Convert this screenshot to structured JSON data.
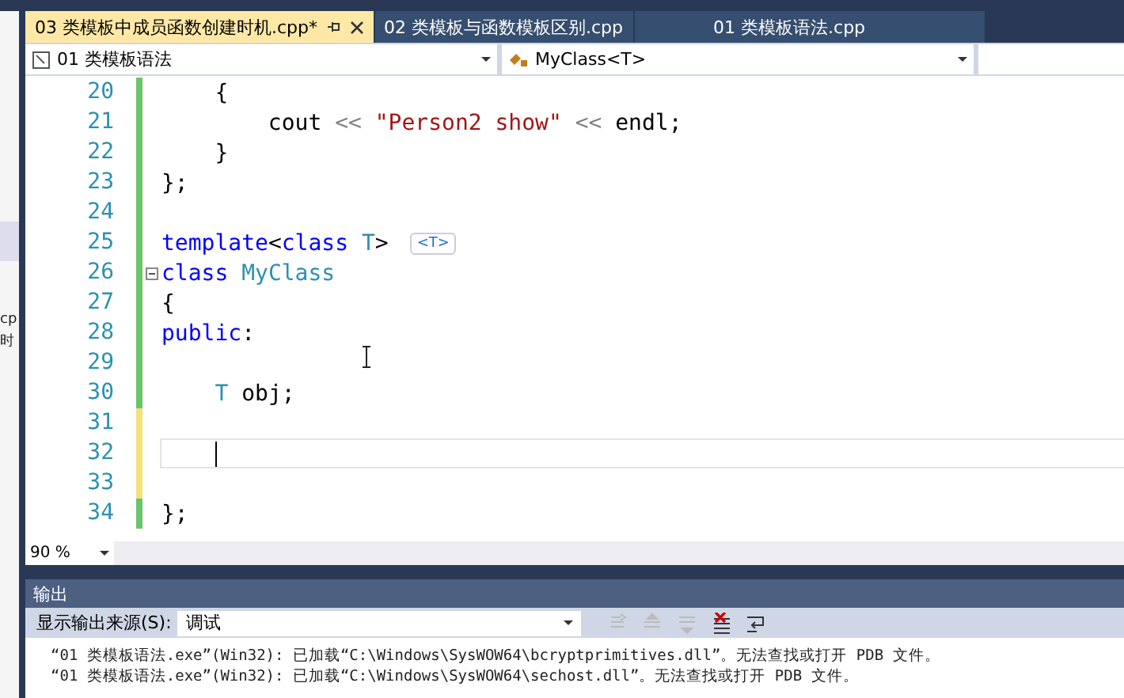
{
  "side_panel": {
    "texts": [
      "cp",
      "时"
    ]
  },
  "tabs": [
    {
      "label": "03 类模板中成员函数创建时机.cpp*",
      "selected": true,
      "pinned": true
    },
    {
      "label": "02 类模板与函数模板区别.cpp",
      "selected": false,
      "pinned": false
    },
    {
      "label": "01 类模板语法.cpp",
      "selected": false,
      "pinned": false
    }
  ],
  "nav_bar": {
    "project": "01 类模板语法",
    "scope": "MyClass<T>"
  },
  "editor": {
    "lines": [
      {
        "number": "20",
        "unsaved": false,
        "current": false,
        "tokens": [
          {
            "kind": "plain",
            "text": "    {"
          }
        ]
      },
      {
        "number": "21",
        "unsaved": false,
        "current": false,
        "tokens": [
          {
            "kind": "plain",
            "text": "        cout "
          },
          {
            "kind": "op",
            "text": "<< "
          },
          {
            "kind": "string",
            "text": "\"Person2 show\""
          },
          {
            "kind": "op",
            "text": " <<"
          },
          {
            "kind": "plain",
            "text": " endl;"
          }
        ]
      },
      {
        "number": "22",
        "unsaved": false,
        "current": false,
        "tokens": [
          {
            "kind": "plain",
            "text": "    }"
          }
        ]
      },
      {
        "number": "23",
        "unsaved": false,
        "current": false,
        "tokens": [
          {
            "kind": "plain",
            "text": "};"
          }
        ]
      },
      {
        "number": "24",
        "unsaved": false,
        "current": false
      },
      {
        "number": "25",
        "unsaved": false,
        "current": false,
        "tokens": [
          {
            "kind": "keyword",
            "text": "template"
          },
          {
            "kind": "plain",
            "text": "<"
          },
          {
            "kind": "keyword",
            "text": "class"
          },
          {
            "kind": "type",
            "text": " T"
          },
          {
            "kind": "plain",
            "text": ">"
          }
        ],
        "hint": "<T>"
      },
      {
        "number": "26",
        "unsaved": false,
        "current": false,
        "fold": true,
        "tokens": [
          {
            "kind": "keyword",
            "text": "class"
          },
          {
            "kind": "type",
            "text": " MyClass"
          }
        ]
      },
      {
        "number": "27",
        "unsaved": false,
        "current": false,
        "tokens": [
          {
            "kind": "plain",
            "text": "{"
          }
        ]
      },
      {
        "number": "28",
        "unsaved": false,
        "current": false,
        "tokens": [
          {
            "kind": "keyword",
            "text": "public"
          },
          {
            "kind": "plain",
            "text": ":"
          }
        ]
      },
      {
        "number": "29",
        "unsaved": false,
        "current": false
      },
      {
        "number": "30",
        "unsaved": false,
        "current": false,
        "tokens": [
          {
            "kind": "type",
            "text": "    T"
          },
          {
            "kind": "plain",
            "text": " obj;"
          }
        ]
      },
      {
        "number": "31",
        "unsaved": true,
        "current": false
      },
      {
        "number": "32",
        "unsaved": true,
        "current": true
      },
      {
        "number": "33",
        "unsaved": true,
        "current": false
      },
      {
        "number": "34",
        "unsaved": false,
        "current": false,
        "tokens": [
          {
            "kind": "plain",
            "text": "};"
          }
        ]
      }
    ],
    "zoom": "90 %"
  },
  "output": {
    "title": "输出",
    "source_label": "显示输出来源(S):",
    "source": "调试",
    "lines": [
      "“01 类模板语法.exe”(Win32): 已加载“C:\\Windows\\SysWOW64\\bcryptprimitives.dll”。无法查找或打开 PDB 文件。",
      "“01 类模板语法.exe”(Win32): 已加载“C:\\Windows\\SysWOW64\\sechost.dll”。无法查找或打开 PDB 文件。"
    ]
  }
}
